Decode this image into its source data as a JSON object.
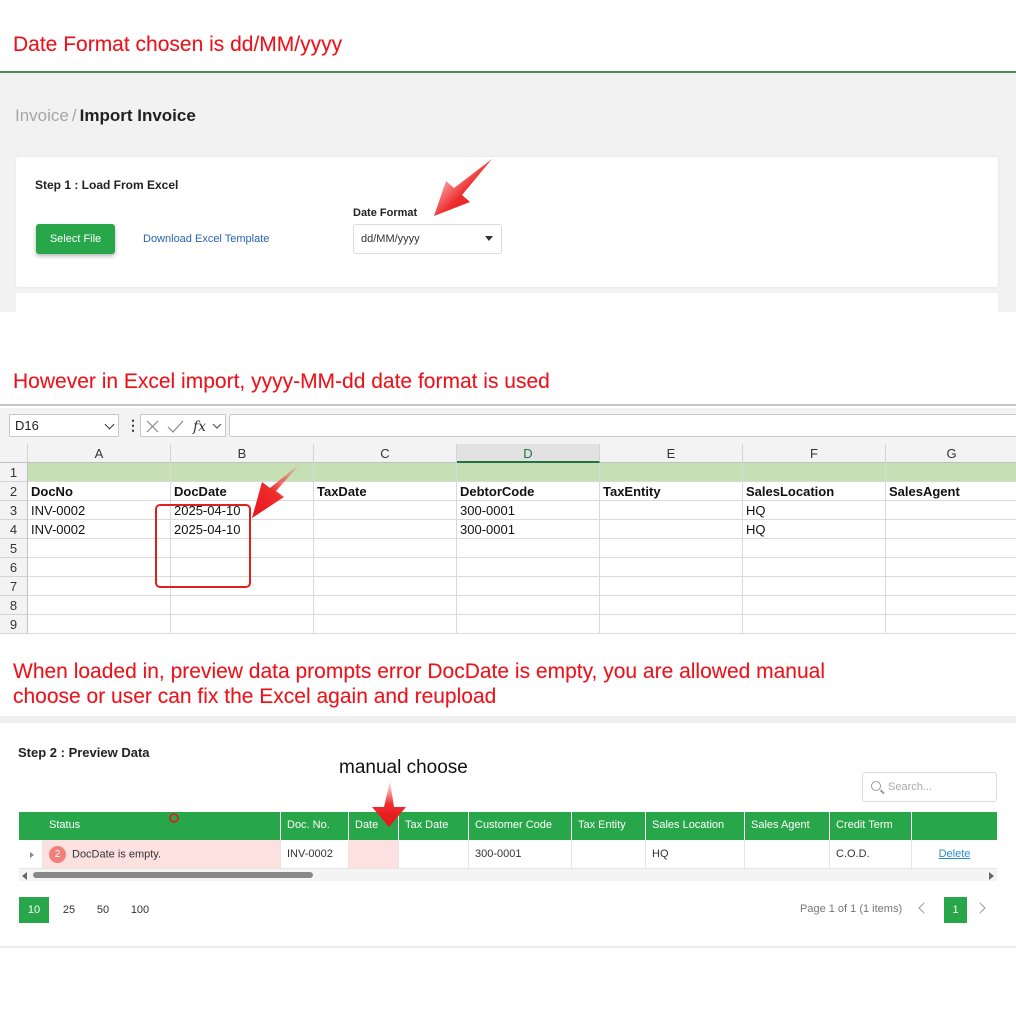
{
  "annotations": {
    "note1": "Date Format chosen is dd/MM/yyyy",
    "note2": "However in Excel import, yyyy-MM-dd date format is used",
    "note3_line1": "When loaded in, preview data prompts error DocDate is empty, you are allowed manual",
    "note3_line2": "choose or user can fix the Excel again and reupload",
    "manual_choose": "manual choose",
    "annotation_color": "#e8141c"
  },
  "app": {
    "breadcrumb": {
      "parent": "Invoice",
      "separator": "/",
      "current": "Import Invoice"
    },
    "step1": {
      "title": "Step 1 : Load From Excel",
      "select_file_label": "Select File",
      "download_template_label": "Download Excel Template",
      "date_format_label": "Date Format",
      "date_format_value": "dd/MM/yyyy"
    },
    "accent_color": "#27a74a"
  },
  "excel": {
    "name_box": "D16",
    "fx_label": "fx",
    "columns": [
      "A",
      "B",
      "C",
      "D",
      "E",
      "F",
      "G"
    ],
    "selected_column": "D",
    "rows": [
      "1",
      "2",
      "3",
      "4",
      "5",
      "6",
      "7",
      "8",
      "9"
    ],
    "header_row": [
      "DocNo",
      "DocDate",
      "TaxDate",
      "DebtorCode",
      "TaxEntity",
      "SalesLocation",
      "SalesAgent"
    ],
    "data_rows": [
      [
        "INV-0002",
        "2025-04-10",
        "",
        "300-0001",
        "",
        "HQ",
        ""
      ],
      [
        "INV-0002",
        "2025-04-10",
        "",
        "300-0001",
        "",
        "HQ",
        ""
      ]
    ]
  },
  "preview": {
    "title": "Step 2 : Preview Data",
    "search_placeholder": "Search...",
    "columns": [
      "Status",
      "Doc. No.",
      "Date",
      "Tax Date",
      "Customer Code",
      "Tax Entity",
      "Sales Location",
      "Sales Agent",
      "Credit Term",
      ""
    ],
    "row": {
      "error_count": "2",
      "status": "DocDate is empty.",
      "doc_no": "INV-0002",
      "date": "",
      "tax_date": "",
      "customer_code": "300-0001",
      "tax_entity": "",
      "sales_location": "HQ",
      "sales_agent": "",
      "credit_term": "C.O.D.",
      "action": "Delete"
    },
    "page_sizes": [
      "10",
      "25",
      "50",
      "100"
    ],
    "active_page_size": "10",
    "pager_info": "Page 1 of 1 (1 items)",
    "current_page": "1",
    "error_bg": "#fde1e1"
  }
}
